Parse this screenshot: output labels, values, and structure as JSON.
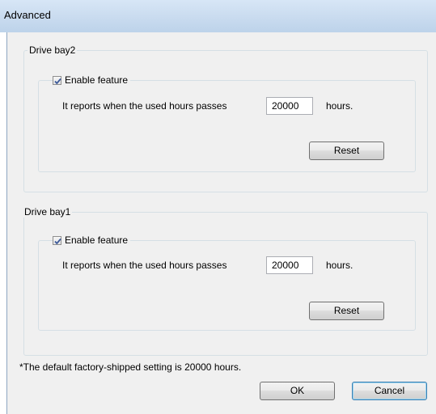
{
  "window": {
    "title": "Advanced"
  },
  "groups": [
    {
      "label": "Drive bay2",
      "enable_label": "Enable feature",
      "enabled": true,
      "description": "It reports when the used hours passes",
      "hours_value": "20000",
      "unit": "hours.",
      "reset_label": "Reset"
    },
    {
      "label": "Drive bay1",
      "enable_label": "Enable feature",
      "enabled": true,
      "description": "It reports when the used hours passes",
      "hours_value": "20000",
      "unit": "hours.",
      "reset_label": "Reset"
    }
  ],
  "footnote": "*The default factory-shipped setting is 20000 hours.",
  "buttons": {
    "ok": "OK",
    "cancel": "Cancel"
  },
  "icons": {
    "checkbox_check": "checkmark-icon",
    "check_color": "#3d5a9a"
  }
}
